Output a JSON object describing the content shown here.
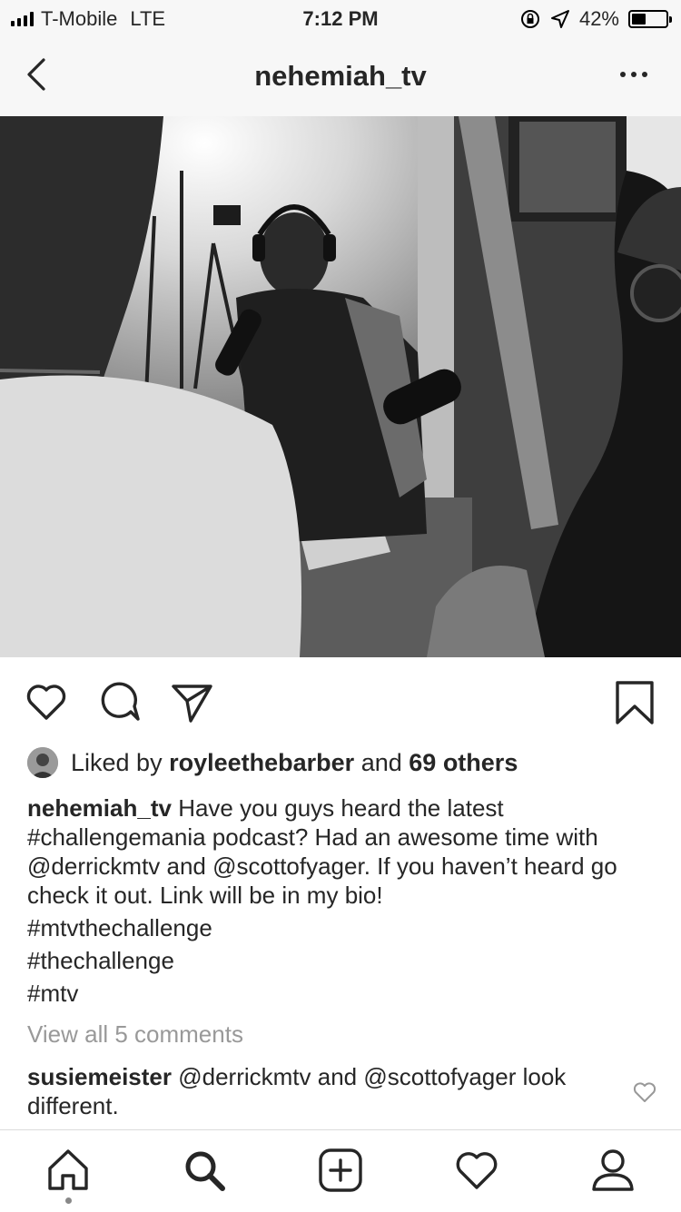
{
  "status_bar": {
    "carrier": "T-Mobile",
    "network": "LTE",
    "time": "7:12 PM",
    "battery_percent_text": "42%",
    "battery_level": 0.42,
    "icons": [
      "signal-bars-icon",
      "rotation-lock-icon",
      "location-arrow-icon",
      "battery-icon"
    ]
  },
  "nav": {
    "title": "nehemiah_tv",
    "back_icon": "chevron-left-icon",
    "more_icon": "more-dots-icon"
  },
  "post": {
    "image_alt_icon": "post-photo",
    "actions": [
      "heart-icon",
      "comment-icon",
      "share-icon",
      "bookmark-icon"
    ],
    "likes": {
      "prefix": "Liked by",
      "user": "royleethebarber",
      "middle": "and",
      "others": "69 others"
    },
    "caption": {
      "username": "nehemiah_tv",
      "text": "Have you guys heard the latest #challengemania podcast? Had an awesome time with @derrickmtv and @scottofyager. If you haven’t heard go check it out. Link will be in my bio!",
      "hashtags": [
        "#mtvthechallenge",
        "#thechallenge",
        "#mtv"
      ]
    },
    "view_all_comments": "View all 5 comments",
    "comment": {
      "username": "susiemeister",
      "text": "@derrickmtv and @scottofyager look different."
    }
  },
  "tab_bar": {
    "tabs": [
      "home-icon",
      "search-icon",
      "new-post-icon",
      "activity-heart-icon",
      "profile-icon"
    ],
    "active": "home-icon"
  }
}
